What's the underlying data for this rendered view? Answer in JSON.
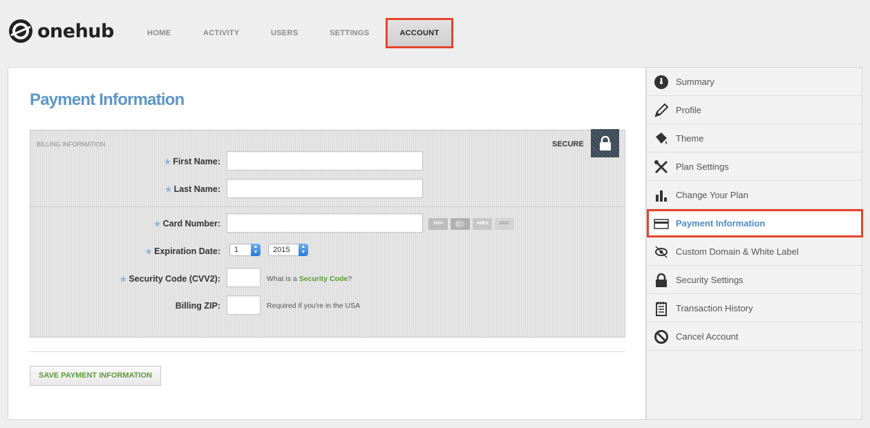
{
  "app": {
    "logo_text": "onehub"
  },
  "nav": {
    "items": [
      {
        "label": "HOME"
      },
      {
        "label": "ACTIVITY"
      },
      {
        "label": "USERS"
      },
      {
        "label": "SETTINGS"
      },
      {
        "label": "ACCOUNT",
        "active": true
      }
    ]
  },
  "page": {
    "title": "Payment Information"
  },
  "billing": {
    "section_label": "BILLING INFORMATION",
    "secure_label": "SECURE",
    "first_name": {
      "label": "First Name:",
      "value": ""
    },
    "last_name": {
      "label": "Last Name:",
      "value": ""
    },
    "card_number": {
      "label": "Card Number:",
      "value": ""
    },
    "cards": [
      "VISA",
      "",
      "AMEX",
      "DISC"
    ],
    "expiration": {
      "label": "Expiration Date:",
      "month": "1",
      "year": "2015"
    },
    "security_code": {
      "label": "Security Code (CVV2):",
      "value": "",
      "hint_prefix": "What is a ",
      "hint_link": "Security Code",
      "hint_suffix": "?"
    },
    "billing_zip": {
      "label": "Billing ZIP:",
      "value": "",
      "hint": "Required if you're in the USA"
    },
    "required_mark": "★"
  },
  "actions": {
    "save_label": "SAVE PAYMENT INFORMATION"
  },
  "sidebar": {
    "items": [
      {
        "label": "Summary",
        "icon": "speedometer-icon"
      },
      {
        "label": "Profile",
        "icon": "pencil-icon"
      },
      {
        "label": "Theme",
        "icon": "paint-bucket-icon"
      },
      {
        "label": "Plan Settings",
        "icon": "tools-icon"
      },
      {
        "label": "Change Your Plan",
        "icon": "bar-chart-icon"
      },
      {
        "label": "Payment Information",
        "icon": "credit-card-icon",
        "active": true
      },
      {
        "label": "Custom Domain & White Label",
        "icon": "eye-icon"
      },
      {
        "label": "Security Settings",
        "icon": "lock-icon"
      },
      {
        "label": "Transaction History",
        "icon": "notepad-icon"
      },
      {
        "label": "Cancel Account",
        "icon": "prohibited-icon"
      }
    ]
  },
  "colors": {
    "accent": "#5d96c7",
    "highlight": "#e8432b",
    "link_green": "#5a9a36"
  }
}
